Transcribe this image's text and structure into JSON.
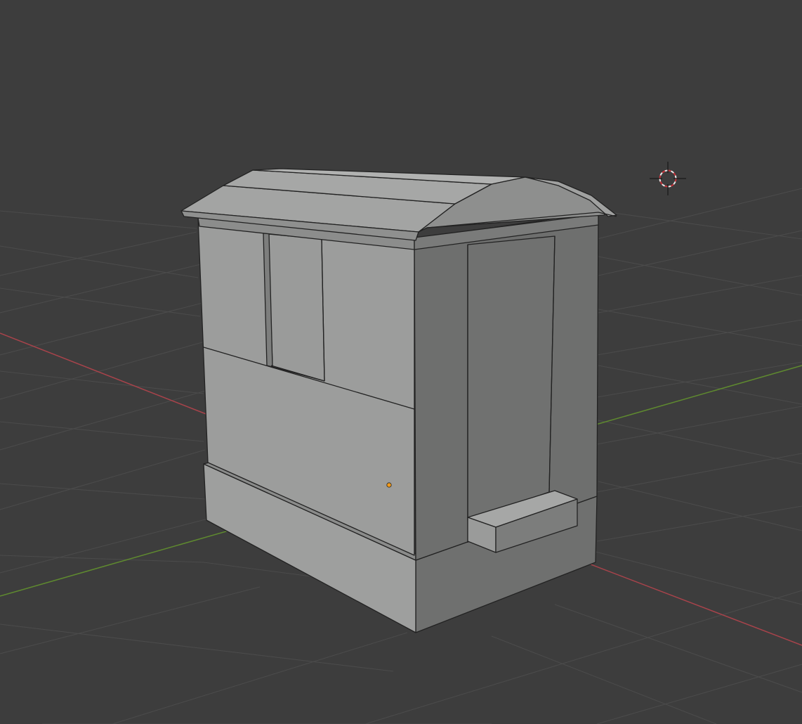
{
  "viewport": {
    "background": "#3d3d3d",
    "grid_color": "#4a4a4a",
    "x_axis_color": "#a8434b",
    "y_axis_color": "#5f8a2f",
    "mesh_light_face": "#9c9d9c",
    "mesh_mid_face": "#868786",
    "mesh_dark_face": "#6f706f",
    "mesh_edge": "#222222",
    "origin_color": "#f29a1a",
    "cursor_color": "#d8d8d8",
    "cursor_accent": "#c8323a"
  },
  "objects": {
    "active_object": "caravan-mesh",
    "cursor": "3d-cursor-icon",
    "origin": "object-origin-icon"
  }
}
